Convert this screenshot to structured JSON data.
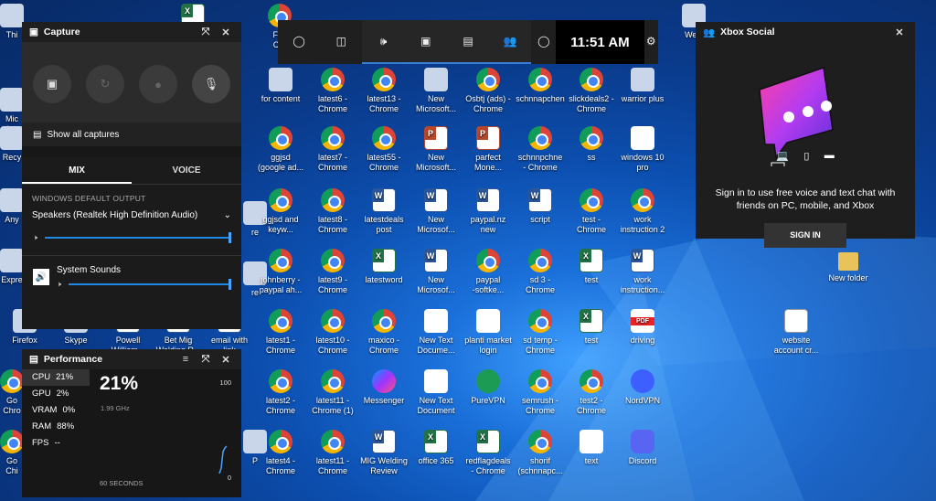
{
  "desktop_icons": [
    {
      "id": "di-this",
      "label": "Thi",
      "type": "generic"
    },
    {
      "id": "di-mic",
      "label": "Mic\ndata",
      "type": "generic"
    },
    {
      "id": "di-recy",
      "label": "Recy",
      "type": "generic"
    },
    {
      "id": "di-any",
      "label": "Any",
      "type": "generic"
    },
    {
      "id": "di-expr",
      "label": "Expre",
      "type": "generic"
    },
    {
      "id": "di-firefox",
      "label": "Firefox",
      "type": "generic"
    },
    {
      "id": "di-go1",
      "label": "Go\nChro",
      "type": "chrome"
    },
    {
      "id": "di-go2",
      "label": "Go\nChi",
      "type": "chrome"
    },
    {
      "id": "di-skype",
      "label": "Skype",
      "type": "generic"
    },
    {
      "id": "di-powell",
      "label": "Powell\nWilliam...",
      "type": "word"
    },
    {
      "id": "di-betmig",
      "label": "Bet Mig\nWelding R...",
      "type": "word"
    },
    {
      "id": "di-email",
      "label": "email with\nlink",
      "type": "word"
    },
    {
      "id": "di-re",
      "label": "re",
      "type": "generic"
    },
    {
      "id": "di-re2",
      "label": "re",
      "type": "generic"
    },
    {
      "id": "di-p",
      "label": "P",
      "type": "generic"
    },
    {
      "id": "di-fgs",
      "label": "Fgs\nChr",
      "type": "chrome"
    },
    {
      "id": "di-forcontent",
      "label": "for content",
      "type": "generic"
    },
    {
      "id": "di-ggjsd",
      "label": "ggjsd\n(google ad...",
      "type": "chrome"
    },
    {
      "id": "di-ggjsd2",
      "label": "ggjsd and\nkeyw...",
      "type": "chrome"
    },
    {
      "id": "di-johnberry",
      "label": "johnberry -\npaypal ah...",
      "type": "chrome"
    },
    {
      "id": "di-latest1",
      "label": "latest1 -\nChrome",
      "type": "chrome"
    },
    {
      "id": "di-latest2",
      "label": "latest2 -\nChrome",
      "type": "chrome"
    },
    {
      "id": "di-latest4",
      "label": "latest4 -\nChrome",
      "type": "chrome"
    },
    {
      "id": "di-latest6",
      "label": "latest6 -\nChrome",
      "type": "chrome"
    },
    {
      "id": "di-latest7",
      "label": "latest7 -\nChrome",
      "type": "chrome"
    },
    {
      "id": "di-latest8",
      "label": "latest8 -\nChrome",
      "type": "chrome"
    },
    {
      "id": "di-latest9",
      "label": "latest9 -\nChrome",
      "type": "chrome"
    },
    {
      "id": "di-latest10",
      "label": "latest10 -\nChrome",
      "type": "chrome"
    },
    {
      "id": "di-latest11",
      "label": "latest11 -\nChrome (1)",
      "type": "chrome"
    },
    {
      "id": "di-latest11b",
      "label": "latest11 -\nChrome",
      "type": "chrome"
    },
    {
      "id": "di-latest13",
      "label": "latest13 -\nChrome",
      "type": "chrome"
    },
    {
      "id": "di-latest55",
      "label": "latest55 -\nChrome",
      "type": "chrome"
    },
    {
      "id": "di-latestdeals",
      "label": "latestdeals\npost",
      "type": "word"
    },
    {
      "id": "di-latestword",
      "label": "latestword",
      "type": "excel"
    },
    {
      "id": "di-maxico",
      "label": "maxico -\nChrome",
      "type": "chrome"
    },
    {
      "id": "di-messenger",
      "label": "Messenger",
      "type": "msgr"
    },
    {
      "id": "di-migweld",
      "label": "MIG Welding\nReview",
      "type": "word"
    },
    {
      "id": "di-new1",
      "label": "New\nMicrosoft...",
      "type": "generic"
    },
    {
      "id": "di-new2",
      "label": "New\nMicrosoft...",
      "type": "ppt"
    },
    {
      "id": "di-new3",
      "label": "New\nMicrosof...",
      "type": "word"
    },
    {
      "id": "di-new4",
      "label": "New\nMicrosof...",
      "type": "word"
    },
    {
      "id": "di-newtext1",
      "label": "New Text\nDocume...",
      "type": "doc"
    },
    {
      "id": "di-newtext2",
      "label": "New Text\nDocument",
      "type": "doc"
    },
    {
      "id": "di-office365",
      "label": "office 365",
      "type": "excel"
    },
    {
      "id": "di-osbtj",
      "label": "Osbtj (ads) -\nChrome",
      "type": "chrome"
    },
    {
      "id": "di-parfect",
      "label": "parfect\nMone...",
      "type": "ppt"
    },
    {
      "id": "di-paypalnz",
      "label": "paypal.nz\nnew",
      "type": "word"
    },
    {
      "id": "di-paypalsoft",
      "label": "paypal\n-softke...",
      "type": "chrome"
    },
    {
      "id": "di-planti",
      "label": "planti market\nlogin",
      "type": "doc"
    },
    {
      "id": "di-purevpn",
      "label": "PureVPN",
      "type": "vpn"
    },
    {
      "id": "di-redflag",
      "label": "redflagdeals\n- Chrome",
      "type": "excel"
    },
    {
      "id": "di-schnn",
      "label": "schnnapchen",
      "type": "chrome"
    },
    {
      "id": "di-schnn2",
      "label": "schnnpchne\n- Chrome",
      "type": "chrome"
    },
    {
      "id": "di-script",
      "label": "script",
      "type": "word"
    },
    {
      "id": "di-sd3",
      "label": "sd 3 -\nChrome",
      "type": "chrome"
    },
    {
      "id": "di-sdtemp",
      "label": "sd temp -\nChrome",
      "type": "chrome"
    },
    {
      "id": "di-semrush",
      "label": "semrush -\nChrome",
      "type": "chrome"
    },
    {
      "id": "di-shorif",
      "label": "shorif\n(schnnapc...",
      "type": "chrome"
    },
    {
      "id": "di-slick",
      "label": "slickdeals2 -\nChrome",
      "type": "chrome"
    },
    {
      "id": "di-ss",
      "label": "ss",
      "type": "chrome"
    },
    {
      "id": "di-test",
      "label": "test -\nChrome",
      "type": "chrome"
    },
    {
      "id": "di-testx",
      "label": "test",
      "type": "excel"
    },
    {
      "id": "di-testx2",
      "label": "test",
      "type": "excel"
    },
    {
      "id": "di-test2",
      "label": "test2 -\nChrome",
      "type": "chrome"
    },
    {
      "id": "di-text",
      "label": "text",
      "type": "doc"
    },
    {
      "id": "di-warrior",
      "label": "warrior plus",
      "type": "generic"
    },
    {
      "id": "di-win10",
      "label": "windows 10\npro",
      "type": "doc"
    },
    {
      "id": "di-work",
      "label": "work\ninstruction 2",
      "type": "chrome"
    },
    {
      "id": "di-work2",
      "label": "work\ninstruction...",
      "type": "word"
    },
    {
      "id": "di-driving",
      "label": "driving",
      "type": "pdf"
    },
    {
      "id": "di-nordvpn",
      "label": "NordVPN",
      "type": "nord"
    },
    {
      "id": "di-discord",
      "label": "Discord",
      "type": "discord"
    },
    {
      "id": "di-newfolder",
      "label": "New folder",
      "type": "folder"
    },
    {
      "id": "di-website",
      "label": "website\naccount cr...",
      "type": "web"
    },
    {
      "id": "di-wec",
      "label": "WeC",
      "type": "generic"
    },
    {
      "id": "di-cyan",
      "label": "",
      "type": "excel"
    }
  ],
  "capture": {
    "title": "Capture",
    "show_all": "Show all captures",
    "buttons": [
      "screenshot-icon",
      "record-last-30s-icon",
      "record-icon",
      "mic-off-icon"
    ]
  },
  "audio": {
    "tab_mix": "MIX",
    "tab_voice": "VOICE",
    "section_label": "WINDOWS DEFAULT OUTPUT",
    "device": "Speakers (Realtek High Definition Audio)",
    "master_volume": 1.0,
    "app_name": "System Sounds",
    "app_volume": 1.0
  },
  "performance": {
    "title": "Performance",
    "stats": [
      {
        "name": "CPU",
        "value": "21%"
      },
      {
        "name": "GPU",
        "value": "2%"
      },
      {
        "name": "VRAM",
        "value": "0%"
      },
      {
        "name": "RAM",
        "value": "88%"
      },
      {
        "name": "FPS",
        "value": "--"
      }
    ],
    "big_value": "21%",
    "frequency": "1.99 GHz",
    "scale_max": "100",
    "scale_min": "0",
    "window": "60 SECONDS"
  },
  "topbar": {
    "time": "11:51 AM",
    "buttons": [
      "xbox-icon",
      "audio-widget-icon",
      "volume-icon",
      "capture-icon",
      "performance-icon",
      "social-icon",
      "mouse-icon",
      "settings-icon"
    ]
  },
  "social": {
    "title": "Xbox Social",
    "message": "Sign in to use free voice and text chat with friends on PC, mobile, and Xbox",
    "signin": "SIGN IN"
  }
}
